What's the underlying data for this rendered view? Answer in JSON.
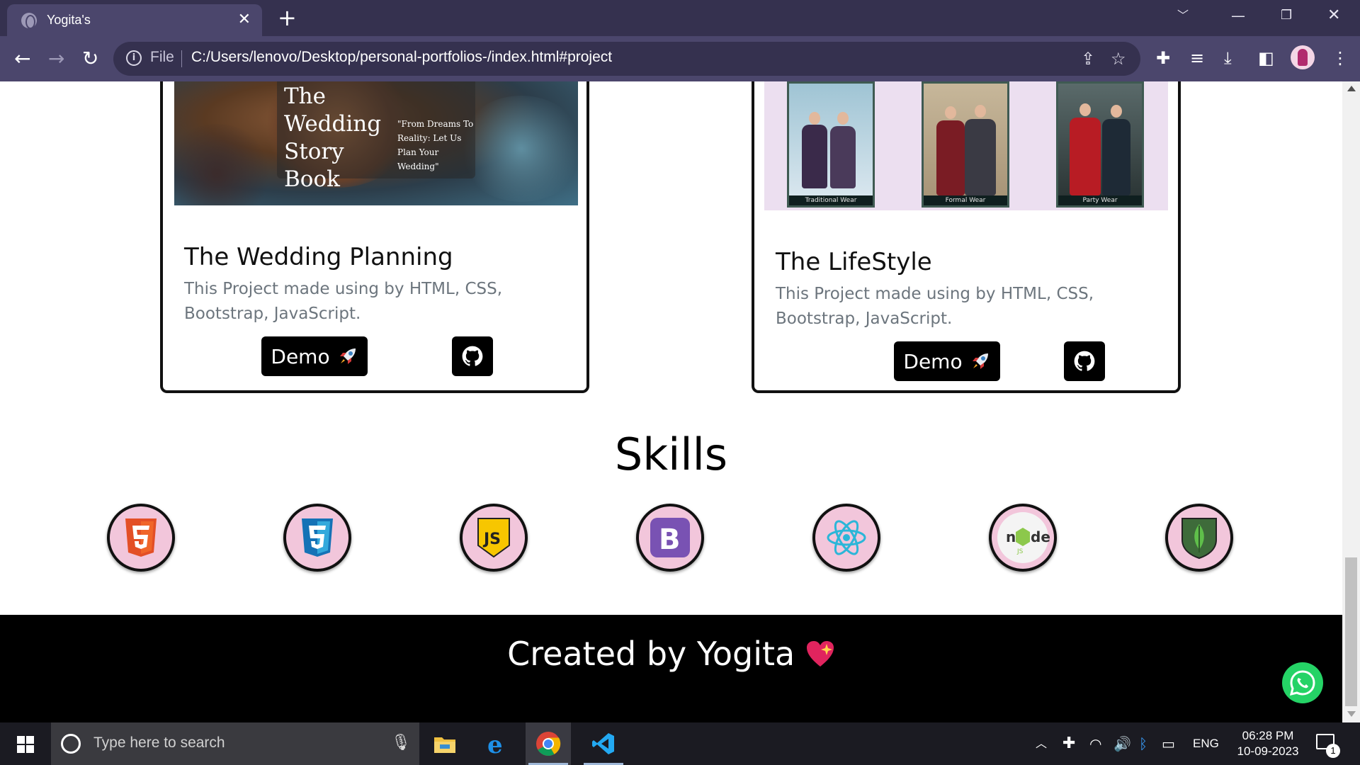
{
  "browser": {
    "tab_title": "Yogita's",
    "tab_close": "✕",
    "new_tab": "+",
    "omnibox_scheme": "File",
    "url": "C:/Users/lenovo/Desktop/personal-portfolios-/index.html#project"
  },
  "projects": [
    {
      "title": "The Wedding Planning",
      "description": "This Project made using by HTML, CSS, Bootstrap, JavaScript.",
      "demo_label": "Demo",
      "image_heading": "The Wedding Story Book",
      "image_quote": "\"From Dreams To Reality: Let Us Plan Your Wedding\""
    },
    {
      "title": "The LifeStyle",
      "description": "This Project made using by HTML, CSS, Bootstrap, JavaScript.",
      "demo_label": "Demo",
      "photo_tags": [
        "Traditional Wear",
        "Formal Wear",
        "Party Wear"
      ]
    }
  ],
  "skills": {
    "title": "Skills",
    "icons": [
      "html5-icon",
      "css3-icon",
      "javascript-icon",
      "bootstrap-icon",
      "react-icon",
      "nodejs-icon",
      "mongodb-icon"
    ]
  },
  "footer": {
    "text": "Created by Yogita"
  },
  "taskbar": {
    "search_placeholder": "Type here to search",
    "language": "ENG",
    "time": "06:28 PM",
    "date": "10-09-2023",
    "notification_count": "1"
  },
  "colors": {
    "chrome_dark": "#35314f",
    "chrome_light": "#4b466c",
    "skill_bg": "#f2c6db",
    "whatsapp": "#25d366"
  }
}
